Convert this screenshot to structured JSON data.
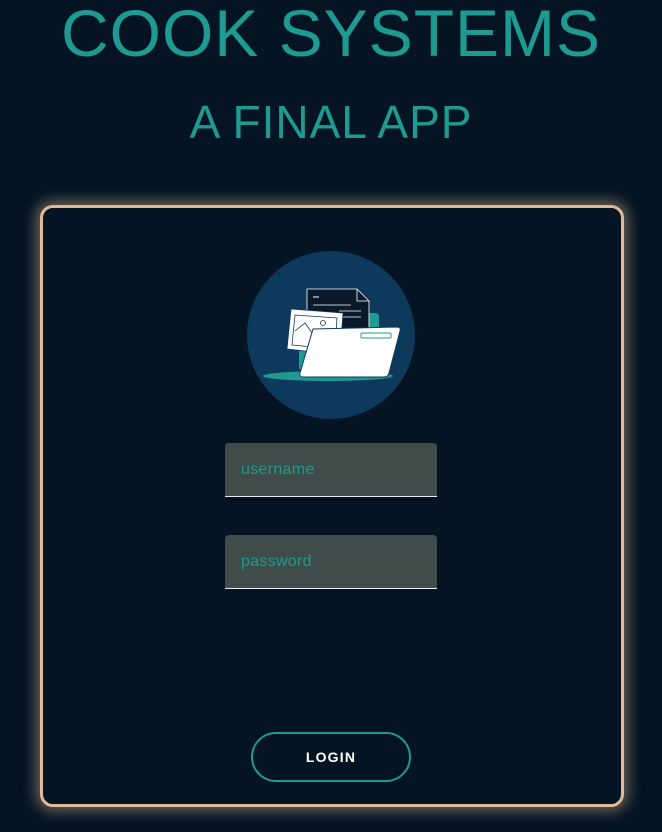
{
  "header": {
    "title": "COOK SYSTEMS",
    "subtitle": "A FINAL APP"
  },
  "login": {
    "illustration": "folder-documents-icon",
    "username_placeholder": "username",
    "username_value": "",
    "password_placeholder": "password",
    "password_value": "",
    "button_label": "LOGIN"
  },
  "colors": {
    "background": "#051422",
    "accent": "#1d9a91",
    "card_border": "#e2b995",
    "avatar_bg": "#0d3a5c",
    "field_bg": "#3e4c4a"
  }
}
